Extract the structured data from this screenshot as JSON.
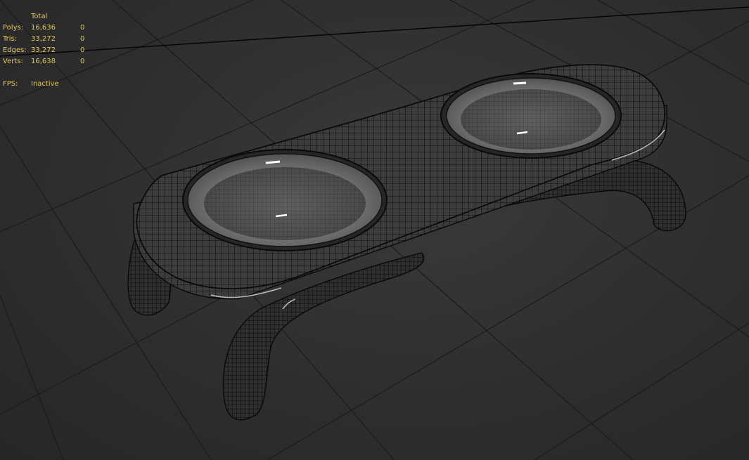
{
  "viewport": {
    "name": "Perspective viewport",
    "background_color": "#2e2e2e",
    "grid_color": "#1a1a1a",
    "stats_color": "#e6c75a"
  },
  "stats": {
    "header": "Total",
    "rows": [
      {
        "label": "Polys:",
        "total": "16,636",
        "selected": "0"
      },
      {
        "label": "Tris:",
        "total": "33,272",
        "selected": "0"
      },
      {
        "label": "Edges:",
        "total": "33,272",
        "selected": "0"
      },
      {
        "label": "Verts:",
        "total": "16,638",
        "selected": "0"
      }
    ],
    "fps_label": "FPS:",
    "fps_value": "Inactive"
  },
  "model": {
    "object": "pet-bowl-stand-wireframe",
    "bowl_count": 2,
    "leg_count": 2
  }
}
